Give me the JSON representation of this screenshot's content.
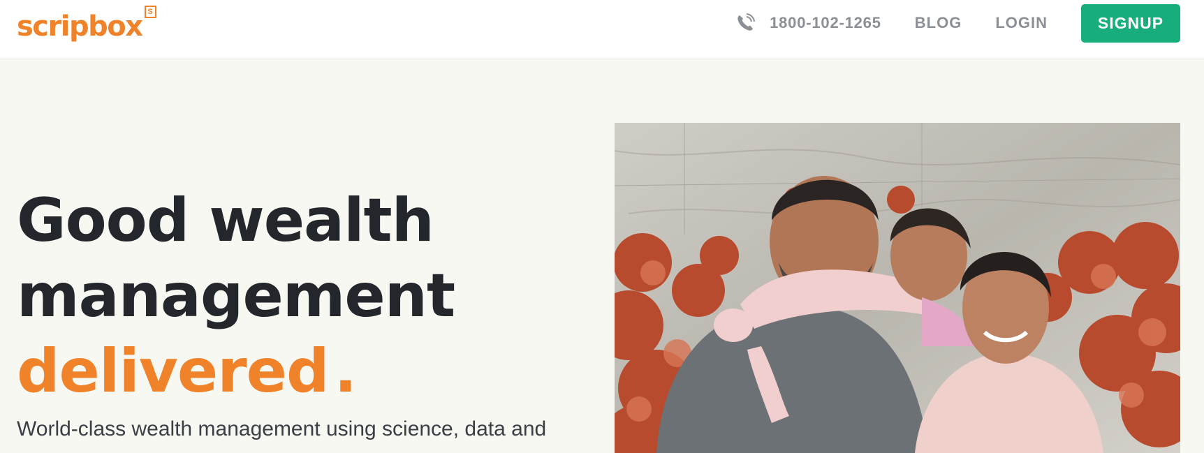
{
  "header": {
    "logo": {
      "text": "scripbox",
      "badge": "S"
    },
    "phone": {
      "icon": "phone-icon",
      "number": "1800-102-1265"
    },
    "nav": {
      "blog": "BLOG",
      "login": "LOGIN",
      "signup": "SIGNUP"
    }
  },
  "hero": {
    "title_line1": "Good wealth",
    "title_line2": "management",
    "title_accent": "delivered",
    "title_dot": ".",
    "subtitle": "World-class wealth management using science, data and"
  },
  "colors": {
    "brand_orange": "#f0822a",
    "signup_green": "#17ad7c",
    "heading_dark": "#23272c",
    "nav_gray": "#8a9096",
    "page_bg": "#f8f8f3"
  }
}
